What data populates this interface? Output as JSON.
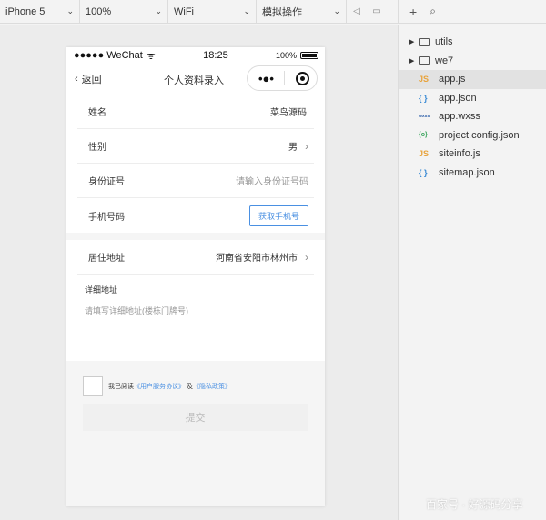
{
  "toolbar": {
    "device": "iPhone 5",
    "zoom": "100%",
    "network": "WiFi",
    "mode": "模拟操作"
  },
  "status_bar": {
    "carrier": "●●●●● WeChat",
    "time": "18:25",
    "battery": "100%"
  },
  "nav": {
    "back_label": "返回",
    "title": "个人资料录入",
    "menu_dots": "•●•"
  },
  "form": {
    "name_label": "姓名",
    "name_value": "菜鸟源码",
    "gender_label": "性别",
    "gender_value": "男",
    "id_label": "身份证号",
    "id_placeholder": "请输入身份证号码",
    "phone_label": "手机号码",
    "phone_button": "获取手机号",
    "address_label": "居住地址",
    "address_value": "河南省安阳市林州市",
    "detail_label": "详细地址",
    "detail_placeholder": "请填写详细地址(楼栋门牌号)"
  },
  "agreement": {
    "prefix": "我已阅读",
    "service_link": "《用户服务协议》",
    "and": "及",
    "privacy_link": "《隐私政策》"
  },
  "submit_label": "提交",
  "files_toolbar": {
    "add_icon": "plus-icon",
    "search_icon": "search-icon"
  },
  "files": [
    {
      "name": "utils",
      "type": "folder"
    },
    {
      "name": "we7",
      "type": "folder"
    },
    {
      "name": "app.js",
      "type": "js",
      "icon": "JS"
    },
    {
      "name": "app.json",
      "type": "json",
      "icon": "{ }"
    },
    {
      "name": "app.wxss",
      "type": "wxss",
      "icon": "wxss"
    },
    {
      "name": "project.config.json",
      "type": "config",
      "icon": "{o}"
    },
    {
      "name": "siteinfo.js",
      "type": "js",
      "icon": "JS"
    },
    {
      "name": "sitemap.json",
      "type": "json",
      "icon": "{ }"
    }
  ],
  "watermark": "百家号 · 好源码分享",
  "colors": {
    "link": "#4a90e2",
    "js_icon": "#e8a33b",
    "json_icon": "#3b8bd4",
    "selected_row": "#e2e2e2"
  }
}
